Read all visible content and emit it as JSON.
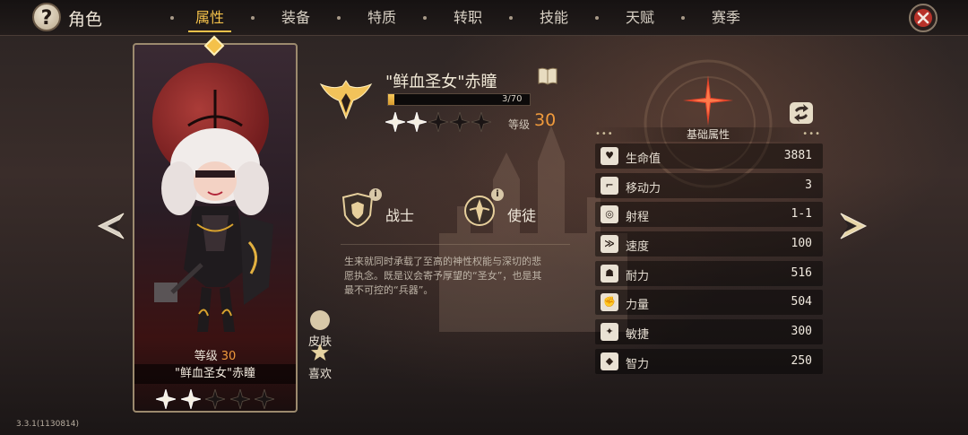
{
  "header": {
    "title": "角色",
    "help_icon": "?",
    "tabs": [
      {
        "label": "属性",
        "active": true
      },
      {
        "label": "装备",
        "active": false
      },
      {
        "label": "特质",
        "active": false
      },
      {
        "label": "转职",
        "active": false
      },
      {
        "label": "技能",
        "active": false
      },
      {
        "label": "天赋",
        "active": false
      },
      {
        "label": "赛季",
        "active": false
      }
    ],
    "close_icon": "close-icon"
  },
  "card": {
    "level_label": "等级",
    "level_value": "30",
    "name": "\"鲜血圣女\"赤瞳",
    "stars_filled": 2,
    "stars_total": 5
  },
  "side_buttons": {
    "skin_label": "皮肤",
    "like_label": "喜欢"
  },
  "character": {
    "name": "\"鲜血圣女\"赤瞳",
    "exp_text": "3/70",
    "exp_fraction": 0.043,
    "rank_stars_filled": 2,
    "rank_stars_total": 5,
    "level_label": "等级",
    "level_value": "30",
    "roles": [
      {
        "label": "战士",
        "icon": "shield-icon"
      },
      {
        "label": "使徒",
        "icon": "apostle-icon"
      }
    ],
    "description": "生来就同时承载了至高的神性权能与深切的悲愿执念。既是议会寄予厚望的“圣女”，也是其最不可控的“兵器”。"
  },
  "attributes": {
    "header": "基础属性",
    "rows": [
      {
        "label": "生命值",
        "value": "3881",
        "icon": "heart-icon"
      },
      {
        "label": "移动力",
        "value": "3",
        "icon": "boot-icon"
      },
      {
        "label": "射程",
        "value": "1-1",
        "icon": "target-icon"
      },
      {
        "label": "速度",
        "value": "100",
        "icon": "wing-icon"
      },
      {
        "label": "耐力",
        "value": "516",
        "icon": "stamina-icon"
      },
      {
        "label": "力量",
        "value": "504",
        "icon": "arm-icon"
      },
      {
        "label": "敏捷",
        "value": "300",
        "icon": "agility-icon"
      },
      {
        "label": "智力",
        "value": "250",
        "icon": "intellect-icon"
      }
    ]
  },
  "colors": {
    "accent": "#f4c14a",
    "level": "#f09a3c"
  },
  "version": "3.3.1(1130814)"
}
